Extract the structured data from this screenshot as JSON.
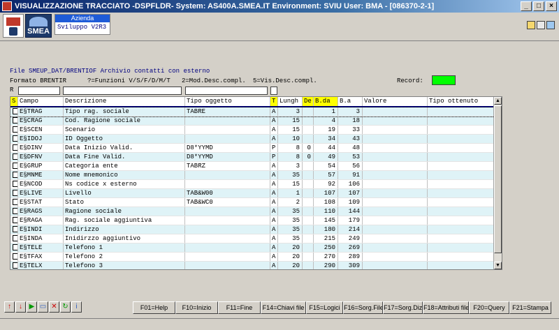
{
  "window": {
    "title": "VISUALIZZAZIONE TRACCIATO -DSPFLDR- System: AS400A.SMEA.IT Environment: SVIU User: BMA - [086370-2-1]",
    "min": "_",
    "max": "□",
    "close": "×"
  },
  "toolbar": {
    "logo": "SMEA",
    "azienda_label": "Azienda",
    "azienda_value": "Sviluppo V2R3"
  },
  "header": {
    "file_line": "File SMEUP_DAT/BRENTIOF Archivio contatti con esterno",
    "formato": "Formato BRENTIR",
    "funzioni": "?=Funzioni V/S/F/D/M/T",
    "mod": "2=Mod.Desc.compl.",
    "vis": "5=Vis.Desc.compl.",
    "record_label": "Record:",
    "r_label": "R"
  },
  "grid": {
    "columns": [
      "S",
      "Campo",
      "Descrizione",
      "Tipo oggetto",
      "T",
      "Lungh",
      "De",
      "B.da",
      "B.a",
      "Valore",
      "Tipo ottenuto"
    ],
    "rows": [
      {
        "campo": "E§TRAG",
        "descr": "Tipo rag. sociale",
        "tipo": "TABRE",
        "t": "A",
        "lungh": "3",
        "de": "",
        "bda": "1",
        "ba": "3"
      },
      {
        "campo": "E§CRAG",
        "descr": "Cod. Ragione sociale",
        "tipo": "",
        "t": "A",
        "lungh": "15",
        "de": "",
        "bda": "4",
        "ba": "18"
      },
      {
        "campo": "E§SCEN",
        "descr": "Scenario",
        "tipo": "",
        "t": "A",
        "lungh": "15",
        "de": "",
        "bda": "19",
        "ba": "33"
      },
      {
        "campo": "E§IDOJ",
        "descr": "ID Oggetto",
        "tipo": "",
        "t": "A",
        "lungh": "10",
        "de": "",
        "bda": "34",
        "ba": "43"
      },
      {
        "campo": "E§DINV",
        "descr": "Data Inizio Valid.",
        "tipo": "D8*YYMD",
        "t": "P",
        "lungh": "8",
        "de": "0",
        "bda": "44",
        "ba": "48"
      },
      {
        "campo": "E§DFNV",
        "descr": "Data Fine Valid.",
        "tipo": "D8*YYMD",
        "t": "P",
        "lungh": "8",
        "de": "0",
        "bda": "49",
        "ba": "53"
      },
      {
        "campo": "E§GRUP",
        "descr": "Categoria ente",
        "tipo": "TABRZ",
        "t": "A",
        "lungh": "3",
        "de": "",
        "bda": "54",
        "ba": "56"
      },
      {
        "campo": "E§MNME",
        "descr": "Nome mnemonico",
        "tipo": "",
        "t": "A",
        "lungh": "35",
        "de": "",
        "bda": "57",
        "ba": "91"
      },
      {
        "campo": "E§NCOD",
        "descr": "Ns codice x esterno",
        "tipo": "",
        "t": "A",
        "lungh": "15",
        "de": "",
        "bda": "92",
        "ba": "106"
      },
      {
        "campo": "E§LIVE",
        "descr": "Livello",
        "tipo": "TAB&W00",
        "t": "A",
        "lungh": "1",
        "de": "",
        "bda": "107",
        "ba": "107"
      },
      {
        "campo": "E§STAT",
        "descr": "Stato",
        "tipo": "TAB&WC0",
        "t": "A",
        "lungh": "2",
        "de": "",
        "bda": "108",
        "ba": "109"
      },
      {
        "campo": "E§RAGS",
        "descr": "Ragione sociale",
        "tipo": "",
        "t": "A",
        "lungh": "35",
        "de": "",
        "bda": "110",
        "ba": "144"
      },
      {
        "campo": "E§RAGA",
        "descr": "Rag. sociale aggiuntiva",
        "tipo": "",
        "t": "A",
        "lungh": "35",
        "de": "",
        "bda": "145",
        "ba": "179"
      },
      {
        "campo": "E§INDI",
        "descr": "Indirizzo",
        "tipo": "",
        "t": "A",
        "lungh": "35",
        "de": "",
        "bda": "180",
        "ba": "214"
      },
      {
        "campo": "E§INDA",
        "descr": "Inidirzzo aggiuntivo",
        "tipo": "",
        "t": "A",
        "lungh": "35",
        "de": "",
        "bda": "215",
        "ba": "249"
      },
      {
        "campo": "E§TELE",
        "descr": "Telefono 1",
        "tipo": "",
        "t": "A",
        "lungh": "20",
        "de": "",
        "bda": "250",
        "ba": "269"
      },
      {
        "campo": "E§TFAX",
        "descr": "Telefono 2",
        "tipo": "",
        "t": "A",
        "lungh": "20",
        "de": "",
        "bda": "270",
        "ba": "289"
      },
      {
        "campo": "E§TELX",
        "descr": "Telefono 3",
        "tipo": "",
        "t": "A",
        "lungh": "20",
        "de": "",
        "bda": "290",
        "ba": "309"
      }
    ]
  },
  "fkeys": [
    "F01=Help",
    "F10=Inizio",
    "F11=Fine",
    "F14=Chiavi file",
    "F15=Logici",
    "F16=Sorg.File",
    "F17=Sorg.Diz.",
    "F18=Attributi file",
    "F20=Query",
    "F21=Stampa"
  ],
  "nav_icons": [
    "arrow-up-icon",
    "arrow-down-icon",
    "play-icon",
    "window-icon",
    "delete-icon",
    "refresh-icon",
    "info-icon"
  ],
  "nav_glyphs": [
    "↑",
    "↓",
    "▶",
    "▭",
    "✕",
    "↻",
    "i"
  ],
  "nav_colors": [
    "#cc0000",
    "#cc0000",
    "#009900",
    "#3060c0",
    "#cc0000",
    "#009900",
    "#3060c0"
  ]
}
